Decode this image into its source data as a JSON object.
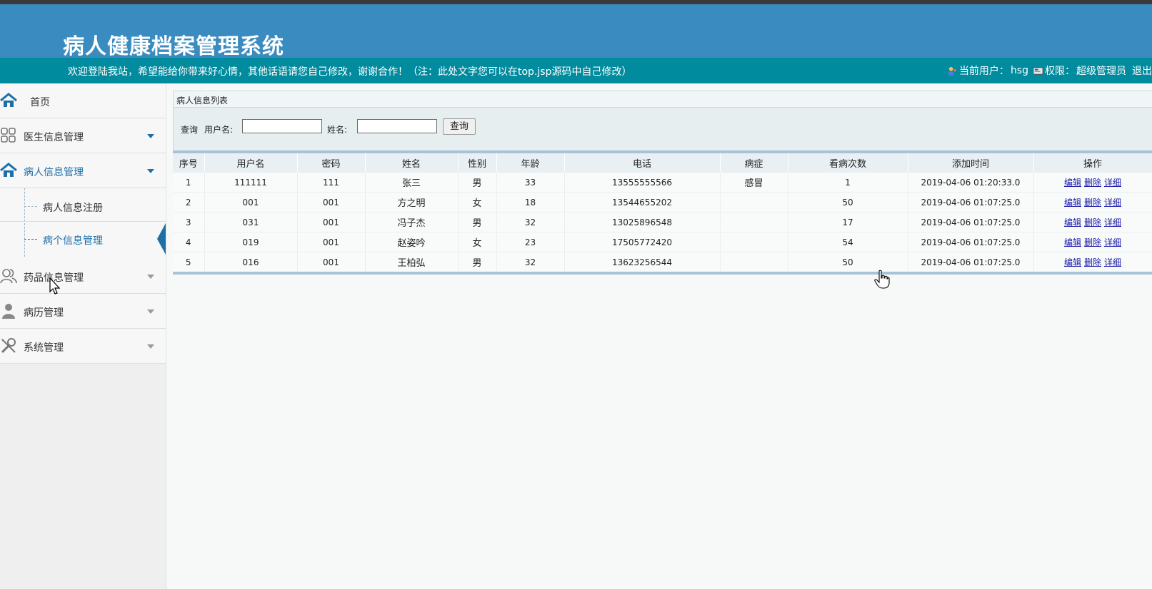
{
  "header": {
    "title": "病人健康档案管理系统"
  },
  "welcome": {
    "message": "欢迎登陆我站，希望能给你带来好心情，其他话语请您自己修改，谢谢合作！（注：此处文字您可以在top.jsp源码中自己修改）",
    "current_user_label": "当前用户：",
    "current_user": "hsg",
    "permission_label": "权限：",
    "permission": "超级管理员",
    "logout": "退出"
  },
  "sidebar": {
    "items": [
      {
        "label": "首页",
        "icon": "home-icon"
      },
      {
        "label": "医生信息管理",
        "icon": "grid-icon"
      },
      {
        "label": "病人信息管理",
        "icon": "home-icon"
      },
      {
        "label": "药品信息管理",
        "icon": "users-icon"
      },
      {
        "label": "病历管理",
        "icon": "user-icon"
      },
      {
        "label": "系统管理",
        "icon": "tools-icon"
      }
    ],
    "subitems": [
      {
        "label": "病人信息注册"
      },
      {
        "label": "病个信息管理"
      }
    ]
  },
  "panel": {
    "title": "病人信息列表"
  },
  "search": {
    "query_label": "查询",
    "username_label": "用户名:",
    "username_value": "",
    "name_label": "姓名:",
    "name_value": "",
    "button": "查询"
  },
  "table": {
    "columns": [
      "序号",
      "用户名",
      "密码",
      "姓名",
      "性别",
      "年龄",
      "电话",
      "病症",
      "看病次数",
      "添加时间",
      "操作"
    ],
    "rows": [
      {
        "seq": "1",
        "username": "111111",
        "password": "111",
        "name": "张三",
        "gender": "男",
        "age": "33",
        "phone": "13555555566",
        "disease": "感冒",
        "visits": "1",
        "added": "2019-04-06 01:20:33.0"
      },
      {
        "seq": "2",
        "username": "001",
        "password": "001",
        "name": "方之明",
        "gender": "女",
        "age": "18",
        "phone": "13544655202",
        "disease": "",
        "visits": "50",
        "added": "2019-04-06 01:07:25.0"
      },
      {
        "seq": "3",
        "username": "031",
        "password": "001",
        "name": "冯子杰",
        "gender": "男",
        "age": "32",
        "phone": "13025896548",
        "disease": "",
        "visits": "17",
        "added": "2019-04-06 01:07:25.0"
      },
      {
        "seq": "4",
        "username": "019",
        "password": "001",
        "name": "赵姿吟",
        "gender": "女",
        "age": "23",
        "phone": "17505772420",
        "disease": "",
        "visits": "54",
        "added": "2019-04-06 01:07:25.0"
      },
      {
        "seq": "5",
        "username": "016",
        "password": "001",
        "name": "王柏弘",
        "gender": "男",
        "age": "32",
        "phone": "13623256544",
        "disease": "",
        "visits": "50",
        "added": "2019-04-06 01:07:25.0"
      }
    ],
    "actions": {
      "edit": "编辑",
      "delete": "删除",
      "detail": "详细"
    }
  },
  "colors": {
    "header_bg": "#3a8bbf",
    "welcome_bg": "#008b9e",
    "accent": "#1e6fa8",
    "link": "#1a1aa8"
  }
}
